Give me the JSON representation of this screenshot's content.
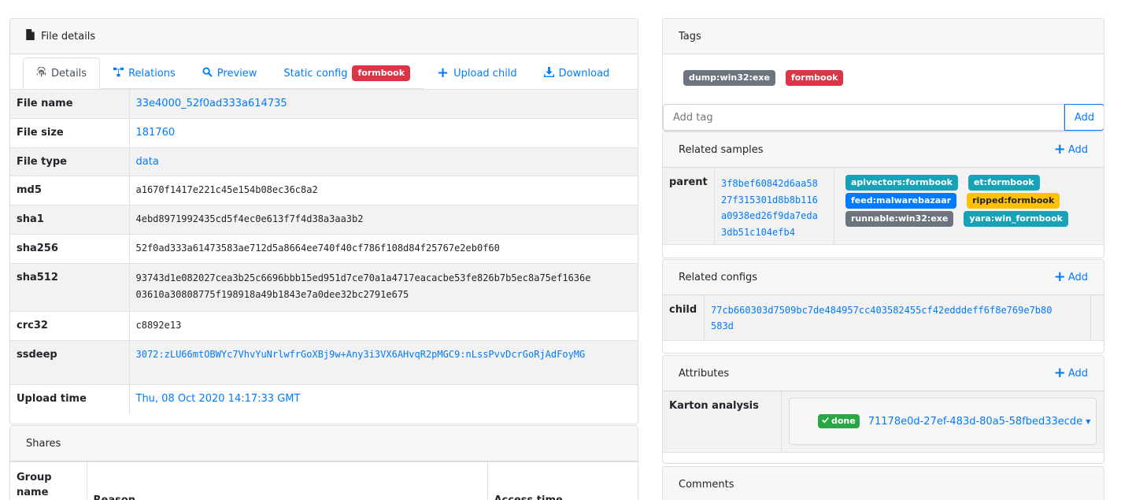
{
  "file_details": {
    "title": "File details",
    "tabs": [
      {
        "label": "Details"
      },
      {
        "label": "Relations"
      },
      {
        "label": "Preview"
      },
      {
        "label": "Static config",
        "badge": "formbook"
      },
      {
        "label": "Upload child"
      },
      {
        "label": "Download"
      }
    ],
    "rows": [
      {
        "key": "File name",
        "value": "33e4000_52f0ad333a614735"
      },
      {
        "key": "File size",
        "value": "181760"
      },
      {
        "key": "File type",
        "value": "data"
      },
      {
        "key": "md5",
        "value": "a1670f1417e221c45e154b08ec36c8a2"
      },
      {
        "key": "sha1",
        "value": "4ebd8971992435cd5f4ec0e613f7f4d38a3aa3b2"
      },
      {
        "key": "sha256",
        "value": "52f0ad333a61473583ae712d5a8664ee740f40cf786f108d84f25767e2eb0f60"
      },
      {
        "key": "sha512",
        "value_line1": "93743d1e082027cea3b25c6696bbb15ed951d7ce70a1a4717eacacbe53fe826b7b5ec8a75ef1636e",
        "value_line2": "03610a30808775f198918a49b1843e7a0dee32bc2791e675"
      },
      {
        "key": "crc32",
        "value": "c8892e13"
      },
      {
        "key": "ssdeep",
        "value": "3072:zLU66mtOBWYc7VhvYuNrlwfrGoXBj9w+Any3i3VX6AHvqR2pMGC9:nLssPvvDcrGoRjAdFoyMG"
      },
      {
        "key": "Upload time",
        "value": "Thu, 08 Oct 2020 14:17:33 GMT"
      }
    ]
  },
  "shares": {
    "title": "Shares",
    "columns": [
      "Group name",
      "Reason",
      "Access time"
    ]
  },
  "tags": {
    "title": "Tags",
    "items": [
      {
        "label": "dump:win32:exe",
        "color": "#6c757d"
      },
      {
        "label": "formbook",
        "color": "#dc3545"
      }
    ],
    "input_placeholder": "Add tag",
    "add_button": "Add"
  },
  "related_samples": {
    "title": "Related samples",
    "add_label": "Add",
    "row_key": "parent",
    "hash_lines": [
      "3f8bef60842d6aa58",
      "27f315301d8b8b116",
      "a0938ed26f9da7eda",
      "3db51c104efb4"
    ],
    "tags": [
      {
        "label": "apivectors:formbook",
        "color": "#17a2b8"
      },
      {
        "label": "et:formbook",
        "color": "#17a2b8"
      },
      {
        "label": "feed:malwarebazaar",
        "color": "#007bff"
      },
      {
        "label": "ripped:formbook",
        "color": "#ffc107"
      },
      {
        "label": "runnable:win32:exe",
        "color": "#6c757d"
      },
      {
        "label": "yara:win_formbook",
        "color": "#17a2b8"
      }
    ]
  },
  "related_configs": {
    "title": "Related configs",
    "add_label": "Add",
    "row_key": "child",
    "hash_line1": "77cb660303d7509bc7de484957cc403582455cf42edddeff6f8e769e7b80",
    "hash_line2": "583d"
  },
  "attributes": {
    "title": "Attributes",
    "add_label": "Add",
    "row_key": "Karton analysis",
    "status": "done",
    "analysis_id": "71178e0d-27ef-483d-80a5-58fbed33ecde"
  },
  "comments": {
    "title": "Comments"
  }
}
